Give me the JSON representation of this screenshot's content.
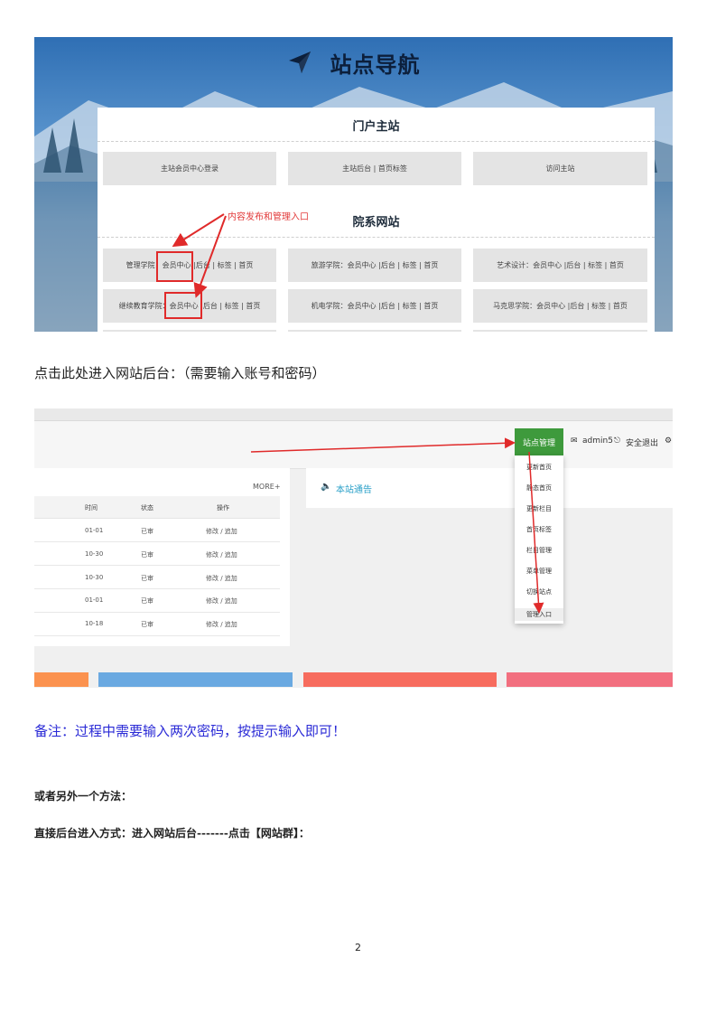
{
  "nav_screenshot": {
    "title": "站点导航",
    "portal": {
      "section_title": "门户主站",
      "cells": [
        "主站会员中心登录",
        "主站后台 | 首页标签",
        "访问主站"
      ]
    },
    "colleges": {
      "section_title": "院系网站",
      "annotation": "内容发布和管理入口",
      "rows": [
        [
          "管理学院：会员中心 |后台 | 标签 | 首页",
          "旅游学院：会员中心 |后台 | 标签 | 首页",
          "艺术设计：会员中心 |后台 | 标签 | 首页"
        ],
        [
          "继续教育学院：会员中心 |后台 | 标签 | 首页",
          "机电学院：会员中心 |后台 | 标签 | 首页",
          "马克思学院：会员中心 |后台 | 标签 | 首页"
        ]
      ]
    }
  },
  "instruction_1": "点击此处进入网站后台：（需要输入账号和密码）",
  "admin_screenshot": {
    "site_manage_button": "站点管理",
    "user": "admin5",
    "logout": "安全退出",
    "dropdown_items": [
      "更新首页",
      "静态首页",
      "更新栏目",
      "首页标签",
      "栏目管理",
      "菜单管理",
      "切换站点",
      "管理入口"
    ],
    "more_link": "MORE+",
    "table": {
      "headers": [
        "时间",
        "状态",
        "操作"
      ],
      "rows": [
        [
          "01-01",
          "已审",
          "修改 / 追加"
        ],
        [
          "10-30",
          "已审",
          "修改 / 追加"
        ],
        [
          "10-30",
          "已审",
          "修改 / 追加"
        ],
        [
          "01-01",
          "已审",
          "修改 / 追加"
        ],
        [
          "10-18",
          "已审",
          "修改 / 追加"
        ]
      ]
    },
    "notice_title": "本站通告",
    "bar_colors": [
      "#fb924f",
      "#6aa9e1",
      "#f76c5e",
      "#f26f7f"
    ]
  },
  "note": "备注：过程中需要输入两次密码，按提示输入即可！",
  "alt_method": "或者另外一个方法：",
  "direct_method": "直接后台进入方式：进入网站后台-------点击【网站群】：",
  "page_number": "2"
}
